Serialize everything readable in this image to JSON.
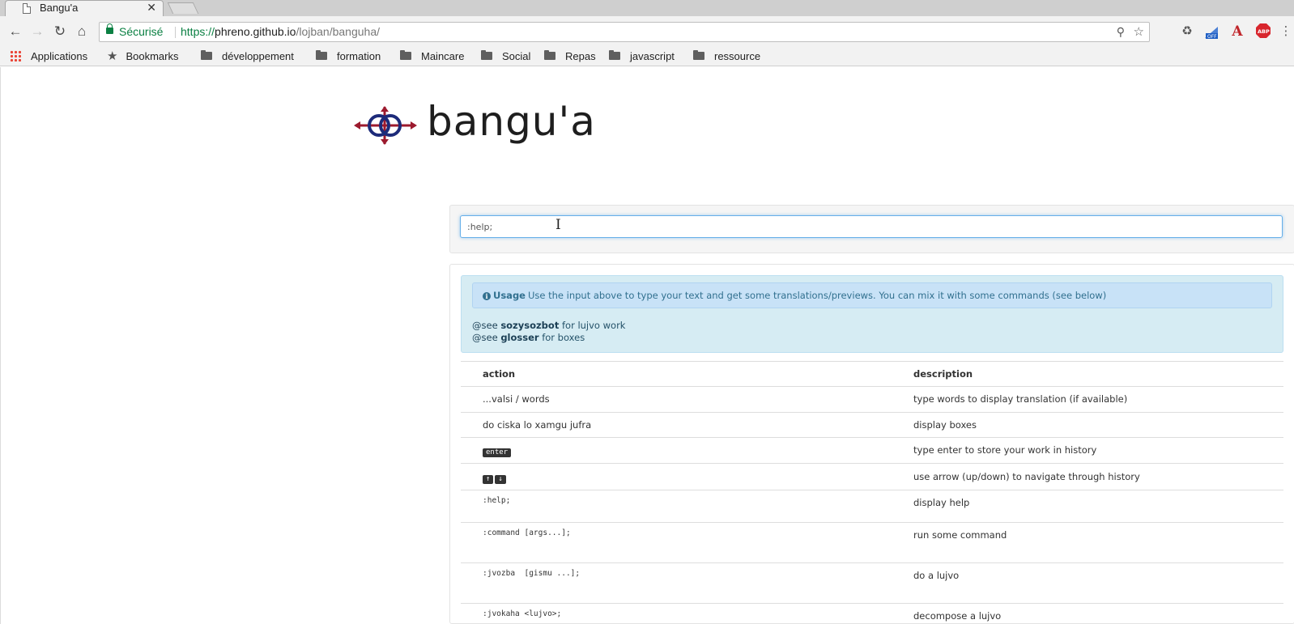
{
  "browser": {
    "tab_title": "Bangu'a",
    "tab_close": "✕",
    "secure_label": "Sécurisé",
    "url_protocol": "https://",
    "url_host": "phreno.github.io",
    "url_path": "/lojban/banguha/"
  },
  "bookmarks": {
    "apps": "Applications",
    "bookmarks": "Bookmarks",
    "folders": [
      "développement",
      "formation",
      "Maincare",
      "Social",
      "Repas",
      "javascript",
      "ressource"
    ]
  },
  "brand": {
    "name": "bangu'a"
  },
  "search": {
    "value": ":help;"
  },
  "help": {
    "usage_label": "Usage",
    "usage_text": "Use the input above to type your text and get some translations/previews. You can mix it with some commands (see below)",
    "see_lines": [
      {
        "kw": "@see",
        "link": "sozysozbot",
        "rest": "for lujvo work"
      },
      {
        "kw": "@see",
        "link": "glosser",
        "rest": "for boxes"
      }
    ],
    "columns": {
      "action": "action",
      "description": "description"
    },
    "rows": [
      {
        "action": "...valsi / words",
        "description": "type words to display translation (if available)"
      },
      {
        "action": "do ciska lo xamgu jufra",
        "description": "display boxes"
      },
      {
        "action": "enter",
        "description": "type enter to store your work in history"
      },
      {
        "keys": [
          "↑",
          "↓"
        ],
        "description": "use arrow (up/down) to navigate through history"
      },
      {
        "action": ":help;",
        "description": "display help"
      },
      {
        "action": ":command [args...];",
        "description": "run some command"
      },
      {
        "action": ":jvozba  [gismu ...];",
        "description": "do a lujvo"
      },
      {
        "action": ":jvokaha <lujvo>;",
        "description": "decompose a lujvo"
      }
    ]
  },
  "colors": {
    "logo_blue": "#1d2b7a",
    "logo_red": "#9c1a2e",
    "secure_green": "#0b8043",
    "info_text": "#31708f"
  }
}
